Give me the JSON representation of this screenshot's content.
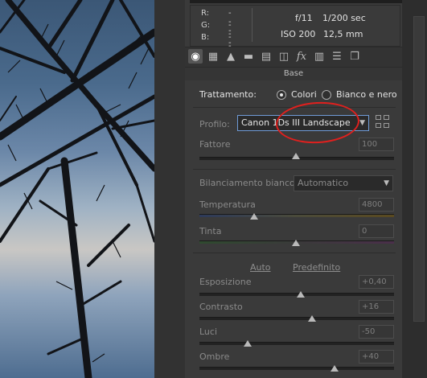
{
  "info": {
    "r_label": "R:",
    "g_label": "G:",
    "b_label": "B:",
    "r_value": "---",
    "g_value": "---",
    "b_value": "---",
    "aperture": "f/11",
    "shutter": "1/200 sec",
    "iso": "ISO 200",
    "focal": "12,5 mm"
  },
  "toolbar": {
    "icons": [
      "aperture-icon",
      "grid-icon",
      "mountain-icon",
      "split-icon",
      "hsl-icon",
      "lens-icon",
      "fx-icon",
      "film-icon",
      "sliders-icon",
      "snapshots-icon"
    ]
  },
  "section": {
    "title": "Base"
  },
  "treatment": {
    "label": "Trattamento:",
    "color_option": "Colori",
    "bw_option": "Bianco e nero",
    "selected": "Colori"
  },
  "profile": {
    "label": "Profilo:",
    "value": "Canon 1Ds III Landscape"
  },
  "amount": {
    "label": "Fattore",
    "value": "100"
  },
  "white_balance": {
    "label": "Bilanciamento bianco:",
    "value": "Automatico"
  },
  "temperature": {
    "label": "Temperatura",
    "value": "4800"
  },
  "tint": {
    "label": "Tinta",
    "value": "0"
  },
  "auto": {
    "auto_label": "Auto",
    "default_label": "Predefinito"
  },
  "exposure": {
    "label": "Esposizione",
    "value": "+0,40"
  },
  "contrast": {
    "label": "Contrasto",
    "value": "+16"
  },
  "highlights": {
    "label": "Luci",
    "value": "-50"
  },
  "shadows": {
    "label": "Ombre",
    "value": "+40"
  },
  "colors": {
    "annotation": "#e0201e",
    "focus": "#6f9bd6"
  }
}
